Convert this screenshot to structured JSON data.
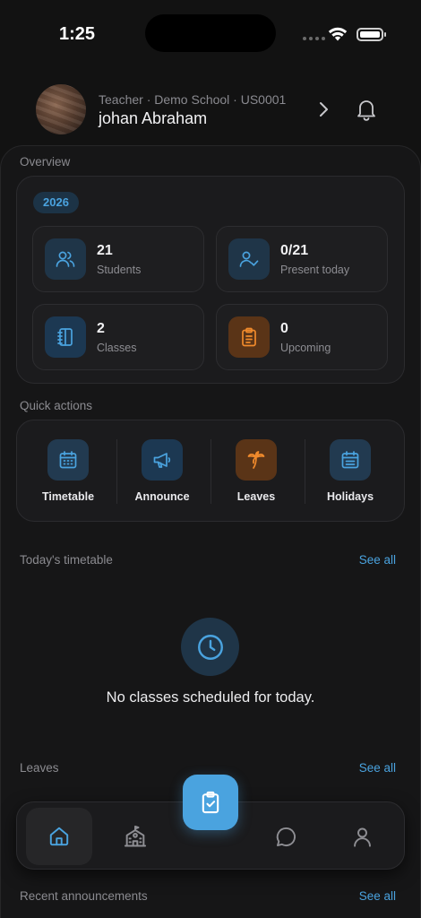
{
  "status_bar": {
    "time": "1:25"
  },
  "profile": {
    "subtitle": "Teacher · Demo School · US0001",
    "name": "johan Abraham"
  },
  "overview": {
    "label": "Overview",
    "year": "2026",
    "stats": [
      {
        "value": "21",
        "label": "Students",
        "icon": "users-icon",
        "color": "#4aa3df"
      },
      {
        "value": "0/21",
        "label": "Present today",
        "icon": "user-check-icon",
        "color": "#4aa3df"
      },
      {
        "value": "2",
        "label": "Classes",
        "icon": "notebook-icon",
        "color": "#4aa3df"
      },
      {
        "value": "0",
        "label": "Upcoming",
        "icon": "clipboard-list-icon",
        "color": "#f08a2c"
      }
    ]
  },
  "quick_actions": {
    "label": "Quick actions",
    "items": [
      {
        "label": "Timetable",
        "icon": "calendar-icon"
      },
      {
        "label": "Announce",
        "icon": "megaphone-icon"
      },
      {
        "label": "Leaves",
        "icon": "palm-tree-icon"
      },
      {
        "label": "Holidays",
        "icon": "calendar-list-icon"
      }
    ]
  },
  "timetable": {
    "label": "Today's timetable",
    "see_all": "See all",
    "empty_text": "No classes scheduled for today.",
    "empty_icon": "clock-icon"
  },
  "leaves": {
    "label": "Leaves",
    "see_all": "See all"
  },
  "announcements": {
    "label": "Recent announcements",
    "see_all": "See all"
  },
  "nav": {
    "items": [
      {
        "icon": "home-icon",
        "active": true
      },
      {
        "icon": "school-icon",
        "active": false
      },
      {
        "icon": "clipboard-check-icon",
        "active": false
      },
      {
        "icon": "chat-icon",
        "active": false
      },
      {
        "icon": "user-icon",
        "active": false
      }
    ]
  },
  "colors": {
    "accent": "#4aa3df",
    "orange": "#f08a2c",
    "background": "#121212",
    "card": "#1b1b1d"
  }
}
